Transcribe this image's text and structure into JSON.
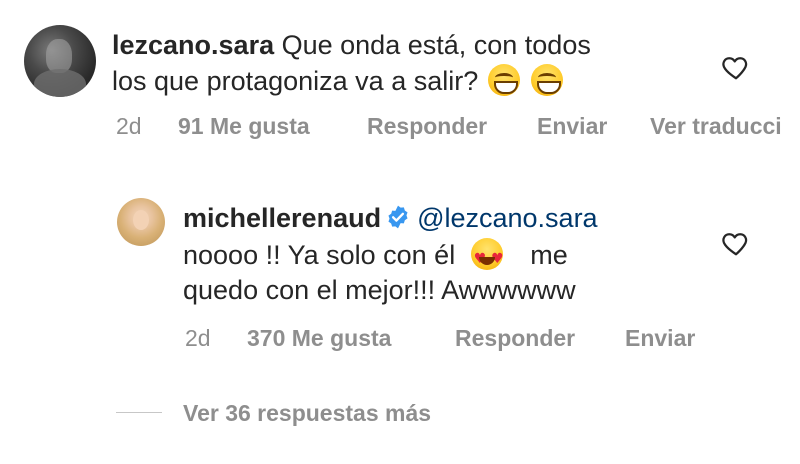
{
  "comments": [
    {
      "username": "lezcano.sara",
      "text_line1": "Que onda está, con todos",
      "text_line2": "los que protagoniza va a salir?",
      "emojis": [
        "grinning-face-icon",
        "grinning-face-icon"
      ],
      "time": "2d",
      "likes": "91 Me gusta",
      "reply_label": "Responder",
      "send_label": "Enviar",
      "translate_label": "Ver traducci"
    },
    {
      "username": "michellerenaud",
      "verified": true,
      "mention": "@lezcano.sara",
      "text_line2_a": "noooo !! Ya solo con él",
      "text_line2_b": "me",
      "text_line3": "quedo con el mejor!!! Awwwwww",
      "emoji": "heart-eyes-face-icon",
      "time": "2d",
      "likes": "370 Me gusta",
      "reply_label": "Responder",
      "send_label": "Enviar"
    }
  ],
  "view_more": "Ver 36 respuestas más",
  "colors": {
    "text": "#262626",
    "meta": "#8e8e8e",
    "mention": "#00376b",
    "verified": "#3897f0"
  }
}
